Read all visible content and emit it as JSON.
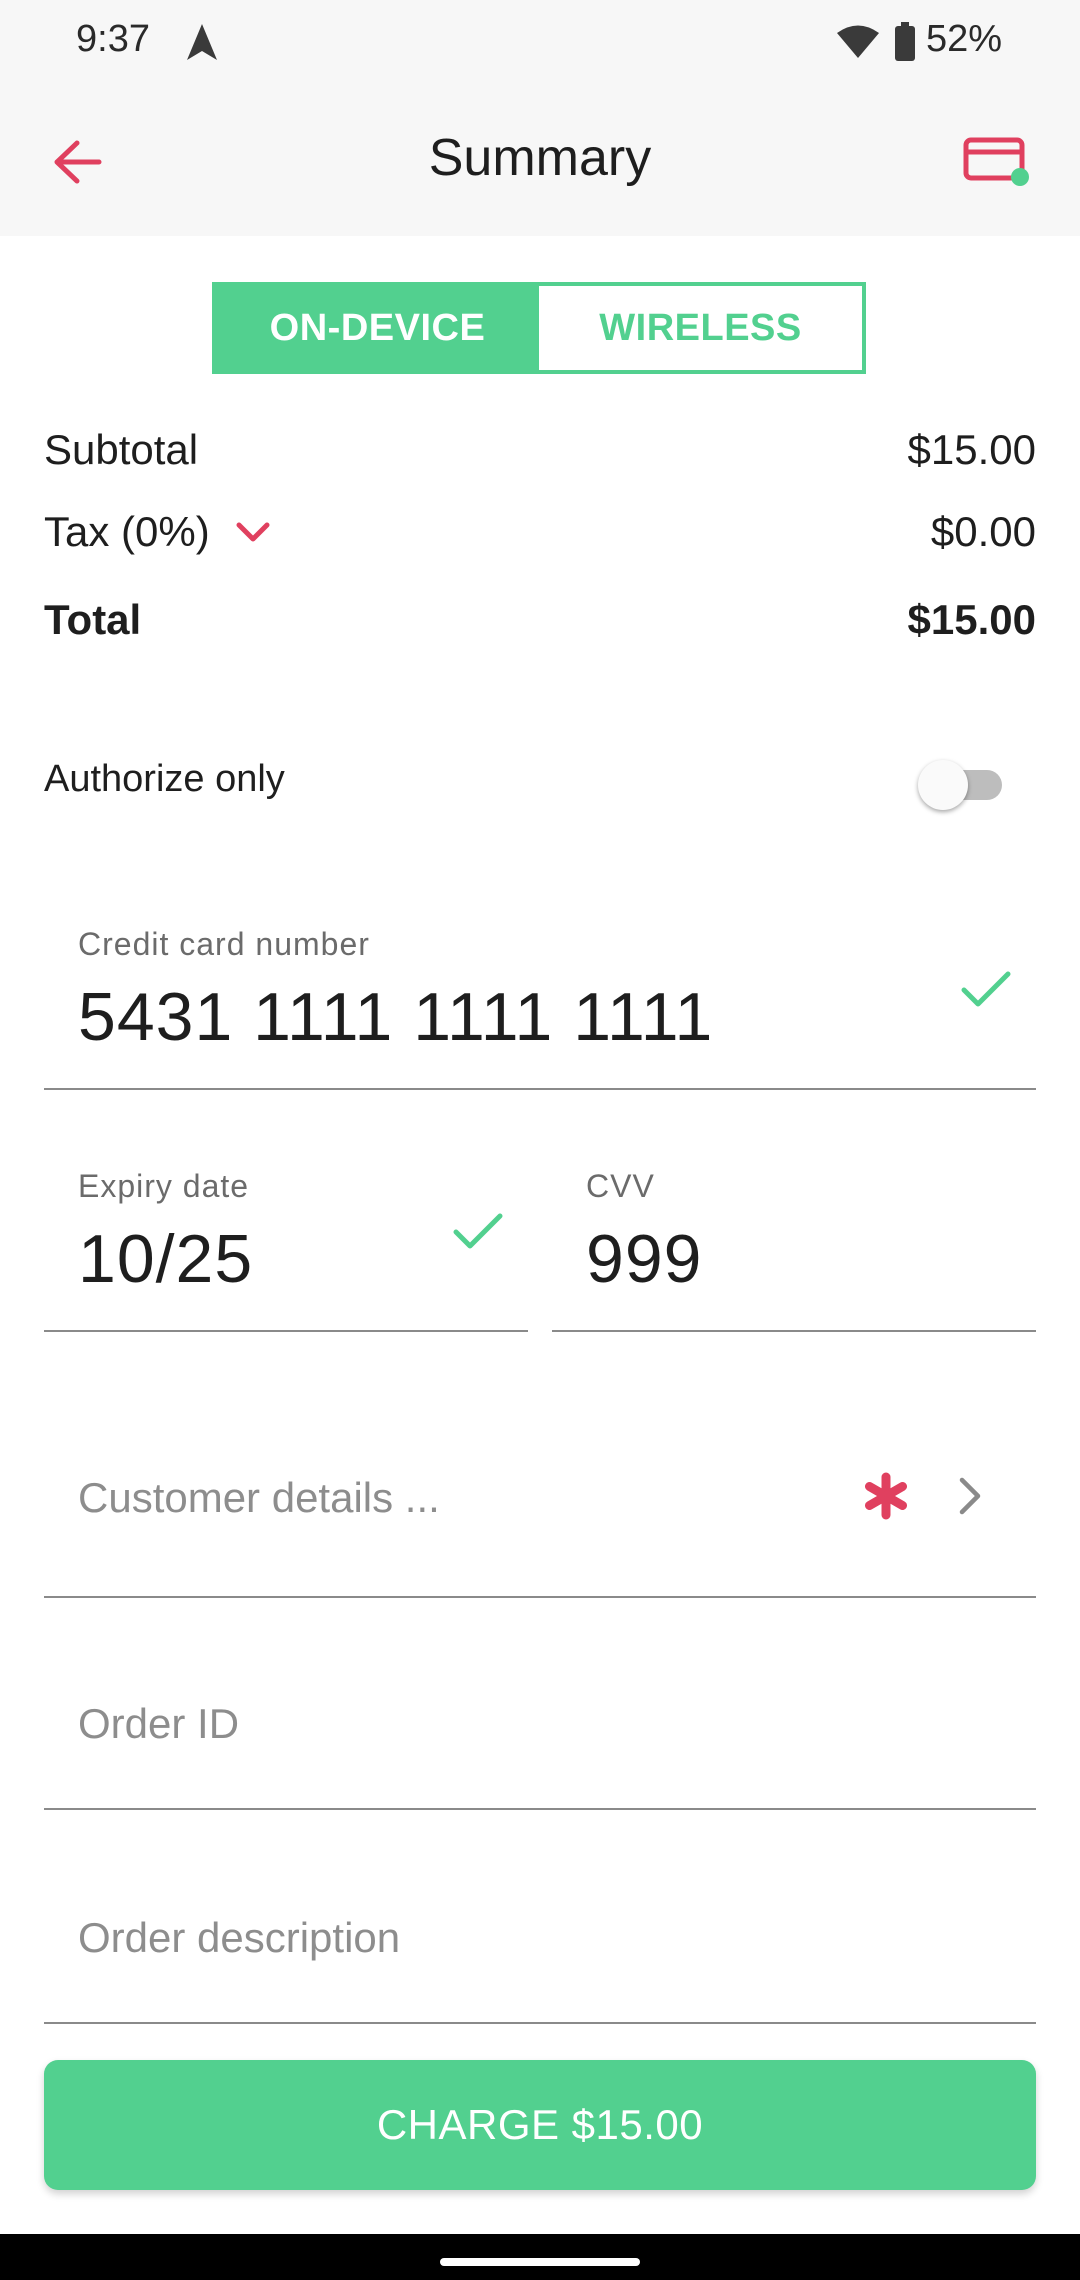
{
  "status_bar": {
    "time": "9:37",
    "battery": "52%",
    "icons": [
      "navigation-arrow-icon",
      "wifi-icon",
      "battery-icon"
    ]
  },
  "app_bar": {
    "title": "Summary",
    "icons": [
      "back-arrow-icon",
      "credit-card-icon"
    ]
  },
  "colors": {
    "accent_green": "#52d08f",
    "accent_pink": "#e0405f",
    "background_bar": "#f7f7f7"
  },
  "mode_toggle": {
    "on_device": "ON-DEVICE",
    "wireless": "WIRELESS",
    "selected": "ON-DEVICE"
  },
  "summary": {
    "subtotal_label": "Subtotal",
    "subtotal_value": "$15.00",
    "tax_label": "Tax (0%)",
    "tax_value": "$0.00",
    "total_label": "Total",
    "total_value": "$15.00"
  },
  "authorize": {
    "label": "Authorize only",
    "enabled": false
  },
  "card": {
    "number_label": "Credit card number",
    "number_value": "5431 1111 1111 1111",
    "expiry_label": "Expiry date",
    "expiry_value": "10/25",
    "cvv_label": "CVV",
    "cvv_value": "999"
  },
  "customer": {
    "placeholder": "Customer details ..."
  },
  "order": {
    "id_placeholder": "Order ID",
    "description_placeholder": "Order description"
  },
  "charge_button": {
    "label": "CHARGE $15.00"
  }
}
